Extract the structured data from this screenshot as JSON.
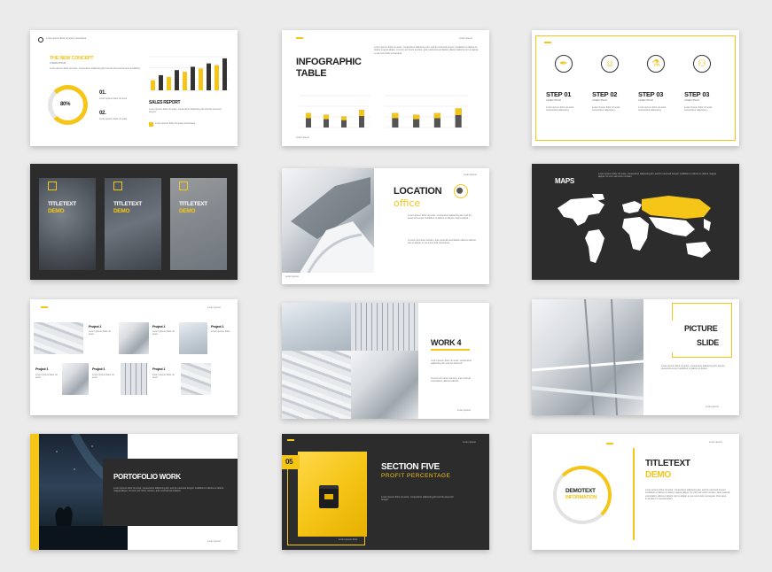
{
  "colors": {
    "accent": "#f5c518",
    "dark": "#2c2c2c",
    "bg": "#ebebeb"
  },
  "s1": {
    "title": "THE NEW CONCEPT",
    "pct": "80%",
    "n1": "01.",
    "n2": "02.",
    "report": "SALES REPORT",
    "bars": [
      0.3,
      0.45,
      0.4,
      0.6,
      0.55,
      0.7,
      0.65,
      0.8,
      0.75,
      0.95
    ]
  },
  "s2": {
    "title1": "INFOGRAPHIC",
    "title2": "TABLE",
    "left_bars": [
      0.45,
      0.4,
      0.35,
      0.55
    ],
    "right_bars": [
      0.45,
      0.4,
      0.45,
      0.6
    ]
  },
  "s3": {
    "steps": [
      {
        "label": "STEP",
        "num": "01",
        "icon": "pen-tool-icon"
      },
      {
        "label": "STEP",
        "num": "02",
        "icon": "person-icon"
      },
      {
        "label": "STEP",
        "num": "03",
        "icon": "microscope-icon"
      },
      {
        "label": "STEP",
        "num": "03",
        "icon": "group-icon"
      }
    ]
  },
  "s4": {
    "cards": [
      {
        "t1": "TITLETEXT",
        "t2": "DEMO"
      },
      {
        "t1": "TITLETEXT",
        "t2": "DEMO"
      },
      {
        "t1": "TITLETEXT",
        "t2": "DEMO"
      }
    ]
  },
  "s5": {
    "title": "LOCATION",
    "sub": "office"
  },
  "s6": {
    "title": "MAPS"
  },
  "s7": {
    "projects": [
      "Project 1",
      "Project 1",
      "Project 1",
      "Project 1",
      "Project 1",
      "Project 1"
    ]
  },
  "s8": {
    "title": "WORK 4"
  },
  "s9": {
    "t1": "PICTURE",
    "t2": "SLIDE"
  },
  "s10": {
    "title": "PORTOFOLIO WORK"
  },
  "s11": {
    "num": "05",
    "title": "SECTION FIVE",
    "sub": "PROFIT PERCENTAGE"
  },
  "s12": {
    "ring1": "DEMOTEXT",
    "ring2": "INFORMATION",
    "t1": "TITLETEXT",
    "t2": "DEMO"
  }
}
